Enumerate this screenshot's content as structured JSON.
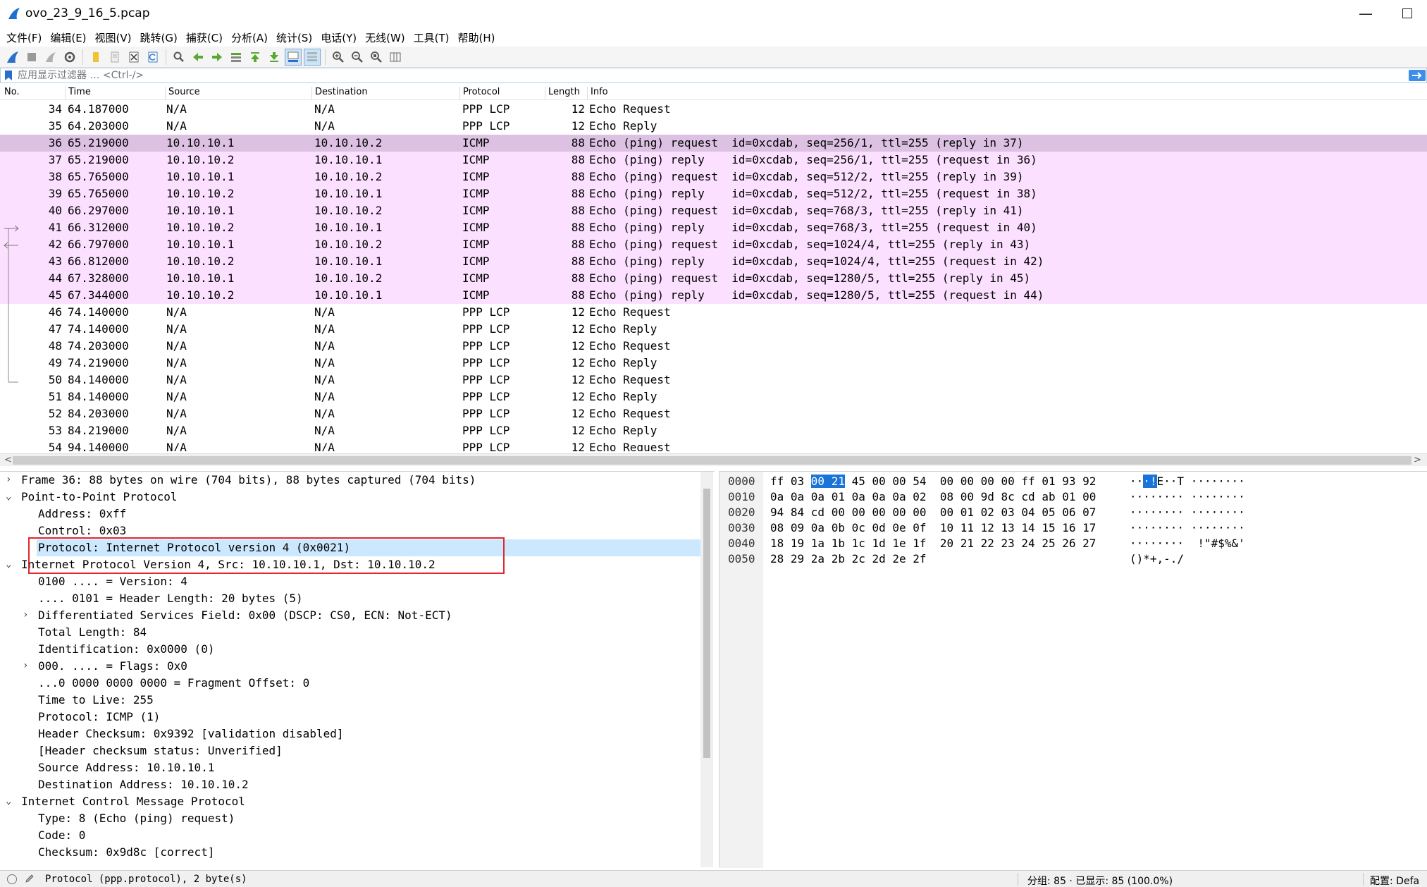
{
  "window": {
    "title": "ovo_23_9_16_5.pcap",
    "minimize": "—"
  },
  "menu": [
    "文件(F)",
    "编辑(E)",
    "视图(V)",
    "跳转(G)",
    "捕获(C)",
    "分析(A)",
    "统计(S)",
    "电话(Y)",
    "无线(W)",
    "工具(T)",
    "帮助(H)"
  ],
  "toolbar_icons": [
    "shark-fin-start-icon",
    "stop-icon",
    "restart-icon",
    "options-gear-icon",
    "open-folder-icon",
    "file-icon",
    "close-file-icon",
    "reload-icon",
    "find-icon",
    "go-back-icon",
    "go-forward-icon",
    "go-to-packet-icon",
    "first-packet-icon",
    "last-packet-icon",
    "autoscroll-icon",
    "colorize-icon",
    "zoom-in-icon",
    "zoom-out-icon",
    "zoom-normal-icon",
    "resize-columns-icon"
  ],
  "filter": {
    "placeholder": "应用显示过滤器 … <Ctrl-/>"
  },
  "columns": {
    "no": "No.",
    "time": "Time",
    "source": "Source",
    "destination": "Destination",
    "protocol": "Protocol",
    "length": "Length",
    "info": "Info"
  },
  "packets": [
    {
      "no": "34",
      "time": "64.187000",
      "src": "N/A",
      "dst": "N/A",
      "proto": "PPP LCP",
      "len": "12",
      "info": "Echo Request",
      "kind": "lcp"
    },
    {
      "no": "35",
      "time": "64.203000",
      "src": "N/A",
      "dst": "N/A",
      "proto": "PPP LCP",
      "len": "12",
      "info": "Echo Reply",
      "kind": "lcp"
    },
    {
      "no": "36",
      "time": "65.219000",
      "src": "10.10.10.1",
      "dst": "10.10.10.2",
      "proto": "ICMP",
      "len": "88",
      "info": "Echo (ping) request  id=0xcdab, seq=256/1, ttl=255 (reply in 37)",
      "kind": "sel"
    },
    {
      "no": "37",
      "time": "65.219000",
      "src": "10.10.10.2",
      "dst": "10.10.10.1",
      "proto": "ICMP",
      "len": "88",
      "info": "Echo (ping) reply    id=0xcdab, seq=256/1, ttl=255 (request in 36)",
      "kind": "icmp"
    },
    {
      "no": "38",
      "time": "65.765000",
      "src": "10.10.10.1",
      "dst": "10.10.10.2",
      "proto": "ICMP",
      "len": "88",
      "info": "Echo (ping) request  id=0xcdab, seq=512/2, ttl=255 (reply in 39)",
      "kind": "icmp"
    },
    {
      "no": "39",
      "time": "65.765000",
      "src": "10.10.10.2",
      "dst": "10.10.10.1",
      "proto": "ICMP",
      "len": "88",
      "info": "Echo (ping) reply    id=0xcdab, seq=512/2, ttl=255 (request in 38)",
      "kind": "icmp"
    },
    {
      "no": "40",
      "time": "66.297000",
      "src": "10.10.10.1",
      "dst": "10.10.10.2",
      "proto": "ICMP",
      "len": "88",
      "info": "Echo (ping) request  id=0xcdab, seq=768/3, ttl=255 (reply in 41)",
      "kind": "icmp"
    },
    {
      "no": "41",
      "time": "66.312000",
      "src": "10.10.10.2",
      "dst": "10.10.10.1",
      "proto": "ICMP",
      "len": "88",
      "info": "Echo (ping) reply    id=0xcdab, seq=768/3, ttl=255 (request in 40)",
      "kind": "icmp"
    },
    {
      "no": "42",
      "time": "66.797000",
      "src": "10.10.10.1",
      "dst": "10.10.10.2",
      "proto": "ICMP",
      "len": "88",
      "info": "Echo (ping) request  id=0xcdab, seq=1024/4, ttl=255 (reply in 43)",
      "kind": "icmp"
    },
    {
      "no": "43",
      "time": "66.812000",
      "src": "10.10.10.2",
      "dst": "10.10.10.1",
      "proto": "ICMP",
      "len": "88",
      "info": "Echo (ping) reply    id=0xcdab, seq=1024/4, ttl=255 (request in 42)",
      "kind": "icmp"
    },
    {
      "no": "44",
      "time": "67.328000",
      "src": "10.10.10.1",
      "dst": "10.10.10.2",
      "proto": "ICMP",
      "len": "88",
      "info": "Echo (ping) request  id=0xcdab, seq=1280/5, ttl=255 (reply in 45)",
      "kind": "icmp"
    },
    {
      "no": "45",
      "time": "67.344000",
      "src": "10.10.10.2",
      "dst": "10.10.10.1",
      "proto": "ICMP",
      "len": "88",
      "info": "Echo (ping) reply    id=0xcdab, seq=1280/5, ttl=255 (request in 44)",
      "kind": "icmp"
    },
    {
      "no": "46",
      "time": "74.140000",
      "src": "N/A",
      "dst": "N/A",
      "proto": "PPP LCP",
      "len": "12",
      "info": "Echo Request",
      "kind": "lcp"
    },
    {
      "no": "47",
      "time": "74.140000",
      "src": "N/A",
      "dst": "N/A",
      "proto": "PPP LCP",
      "len": "12",
      "info": "Echo Reply",
      "kind": "lcp"
    },
    {
      "no": "48",
      "time": "74.203000",
      "src": "N/A",
      "dst": "N/A",
      "proto": "PPP LCP",
      "len": "12",
      "info": "Echo Request",
      "kind": "lcp"
    },
    {
      "no": "49",
      "time": "74.219000",
      "src": "N/A",
      "dst": "N/A",
      "proto": "PPP LCP",
      "len": "12",
      "info": "Echo Reply",
      "kind": "lcp"
    },
    {
      "no": "50",
      "time": "84.140000",
      "src": "N/A",
      "dst": "N/A",
      "proto": "PPP LCP",
      "len": "12",
      "info": "Echo Request",
      "kind": "lcp"
    },
    {
      "no": "51",
      "time": "84.140000",
      "src": "N/A",
      "dst": "N/A",
      "proto": "PPP LCP",
      "len": "12",
      "info": "Echo Reply",
      "kind": "lcp"
    },
    {
      "no": "52",
      "time": "84.203000",
      "src": "N/A",
      "dst": "N/A",
      "proto": "PPP LCP",
      "len": "12",
      "info": "Echo Request",
      "kind": "lcp"
    },
    {
      "no": "53",
      "time": "84.219000",
      "src": "N/A",
      "dst": "N/A",
      "proto": "PPP LCP",
      "len": "12",
      "info": "Echo Reply",
      "kind": "lcp"
    },
    {
      "no": "54",
      "time": "94.140000",
      "src": "N/A",
      "dst": "N/A",
      "proto": "PPP LCP",
      "len": "12",
      "info": "Echo Request",
      "kind": "lcp"
    }
  ],
  "details": [
    {
      "level": 0,
      "expander": "›",
      "text": "Frame 36: 88 bytes on wire (704 bits), 88 bytes captured (704 bits)"
    },
    {
      "level": 0,
      "expander": "⌄",
      "text": "Point-to-Point Protocol"
    },
    {
      "level": 1,
      "expander": "",
      "text": "Address: 0xff"
    },
    {
      "level": 1,
      "expander": "",
      "text": "Control: 0x03"
    },
    {
      "level": 1,
      "expander": "",
      "text": "Protocol: Internet Protocol version 4 (0x0021)",
      "highlight": true
    },
    {
      "level": 0,
      "expander": "⌄",
      "text": "Internet Protocol Version 4, Src: 10.10.10.1, Dst: 10.10.10.2"
    },
    {
      "level": 1,
      "expander": "",
      "text": "0100 .... = Version: 4"
    },
    {
      "level": 1,
      "expander": "",
      "text": ".... 0101 = Header Length: 20 bytes (5)"
    },
    {
      "level": 1,
      "expander": "›",
      "text": "Differentiated Services Field: 0x00 (DSCP: CS0, ECN: Not-ECT)"
    },
    {
      "level": 1,
      "expander": "",
      "text": "Total Length: 84"
    },
    {
      "level": 1,
      "expander": "",
      "text": "Identification: 0x0000 (0)"
    },
    {
      "level": 1,
      "expander": "›",
      "text": "000. .... = Flags: 0x0"
    },
    {
      "level": 1,
      "expander": "",
      "text": "...0 0000 0000 0000 = Fragment Offset: 0"
    },
    {
      "level": 1,
      "expander": "",
      "text": "Time to Live: 255"
    },
    {
      "level": 1,
      "expander": "",
      "text": "Protocol: ICMP (1)"
    },
    {
      "level": 1,
      "expander": "",
      "text": "Header Checksum: 0x9392 [validation disabled]"
    },
    {
      "level": 1,
      "expander": "",
      "text": "[Header checksum status: Unverified]"
    },
    {
      "level": 1,
      "expander": "",
      "text": "Source Address: 10.10.10.1"
    },
    {
      "level": 1,
      "expander": "",
      "text": "Destination Address: 10.10.10.2"
    },
    {
      "level": 0,
      "expander": "⌄",
      "text": "Internet Control Message Protocol"
    },
    {
      "level": 1,
      "expander": "",
      "text": "Type: 8 (Echo (ping) request)"
    },
    {
      "level": 1,
      "expander": "",
      "text": "Code: 0"
    },
    {
      "level": 1,
      "expander": "",
      "text": "Checksum: 0x9d8c [correct]"
    }
  ],
  "bytes": [
    {
      "offset": "0000",
      "hex_pre": "ff 03 ",
      "hex_sel": "00 21",
      "hex_post": " 45 00 00 54  00 00 00 00 ff 01 93 92",
      "asc_pre": "··",
      "asc_sel": "·!",
      "asc_post": "E··T ········"
    },
    {
      "offset": "0010",
      "hex_pre": "0a 0a 0a 01 0a 0a 0a 02  08 00 9d 8c cd ab 01 00",
      "hex_sel": "",
      "hex_post": "",
      "asc_pre": "········ ········",
      "asc_sel": "",
      "asc_post": ""
    },
    {
      "offset": "0020",
      "hex_pre": "94 84 cd 00 00 00 00 00  00 01 02 03 04 05 06 07",
      "hex_sel": "",
      "hex_post": "",
      "asc_pre": "········ ········",
      "asc_sel": "",
      "asc_post": ""
    },
    {
      "offset": "0030",
      "hex_pre": "08 09 0a 0b 0c 0d 0e 0f  10 11 12 13 14 15 16 17",
      "hex_sel": "",
      "hex_post": "",
      "asc_pre": "········ ········",
      "asc_sel": "",
      "asc_post": ""
    },
    {
      "offset": "0040",
      "hex_pre": "18 19 1a 1b 1c 1d 1e 1f  20 21 22 23 24 25 26 27",
      "hex_sel": "",
      "hex_post": "",
      "asc_pre": "········  !\"#$%&'",
      "asc_sel": "",
      "asc_post": ""
    },
    {
      "offset": "0050",
      "hex_pre": "28 29 2a 2b 2c 2d 2e 2f",
      "hex_sel": "",
      "hex_post": "",
      "asc_pre": "()*+,-./",
      "asc_sel": "",
      "asc_post": ""
    }
  ],
  "status": {
    "field": "Protocol (ppp.protocol), 2 byte(s)",
    "packets": "分组: 85 · 已显示: 85 (100.0%)",
    "profile": "配置: Defa"
  },
  "colors": {
    "icmp_row": "#fce0ff",
    "selected_row": "#dcc1e3",
    "byte_selection": "#1a73d9",
    "annotation_box": "#e0282e"
  }
}
